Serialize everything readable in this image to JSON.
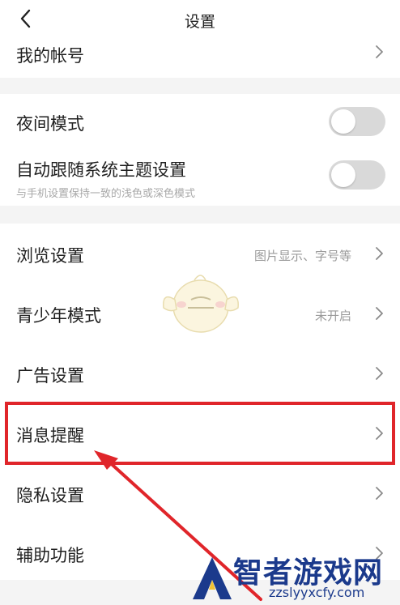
{
  "header": {
    "title": "设置"
  },
  "rows": {
    "account": {
      "label": "我的帐号"
    },
    "night_mode": {
      "label": "夜间模式"
    },
    "follow_system": {
      "label": "自动跟随系统主题设置",
      "sub": "与手机设置保持一致的浅色或深色模式"
    },
    "browse": {
      "label": "浏览设置",
      "value": "图片显示、字号等"
    },
    "teen_mode": {
      "label": "青少年模式",
      "value": "未开启"
    },
    "ads": {
      "label": "广告设置"
    },
    "notifications": {
      "label": "消息提醒"
    },
    "privacy": {
      "label": "隐私设置"
    },
    "accessibility": {
      "label": "辅助功能"
    }
  },
  "toggles": {
    "night_mode_on": false,
    "follow_system_on": false
  },
  "annotation": {
    "highlight_color": "#e0252a"
  },
  "watermark": {
    "title": "智者游戏网",
    "url": "zzslyyxcfy.com"
  },
  "colors": {
    "background": "#f4f4f4",
    "toggle_off": "#d9d9d9",
    "watermark": "#1b3a8c"
  }
}
